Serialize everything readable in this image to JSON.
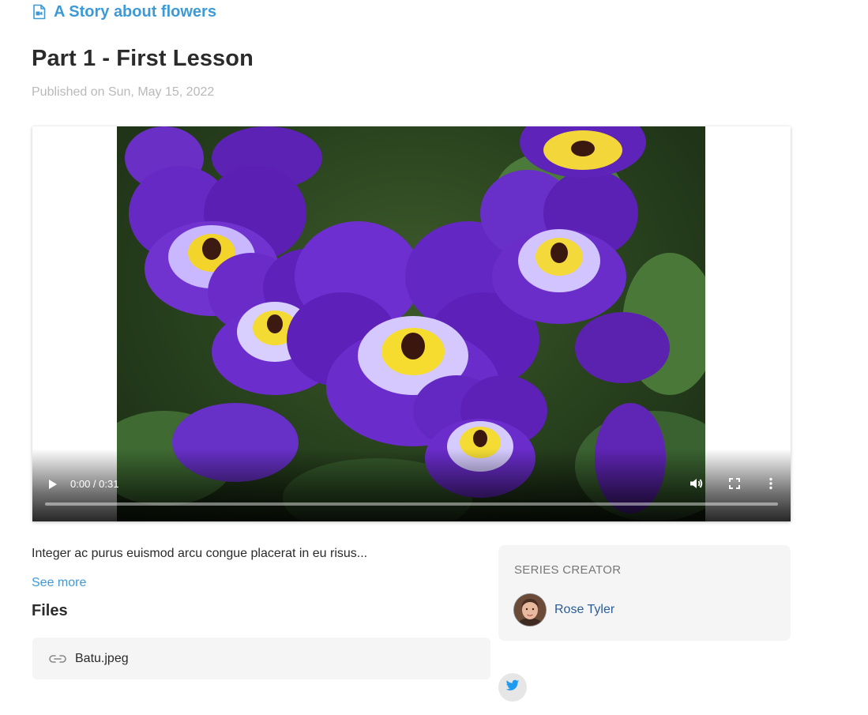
{
  "series": {
    "title": "A Story about flowers",
    "icon": "video-file-icon"
  },
  "episode": {
    "title": "Part 1 - First Lesson",
    "published": "Published on Sun, May 15, 2022"
  },
  "video_player": {
    "time_display": "0:00 / 0:31",
    "progress": 0,
    "icons": [
      "play-icon",
      "volume-icon",
      "fullscreen-icon",
      "more-options-icon"
    ]
  },
  "description": {
    "text": "Integer ac purus euismod arcu congue placerat in eu risus...",
    "see_more_label": "See more"
  },
  "files": {
    "heading": "Files",
    "items": [
      {
        "name": "Batu.jpeg",
        "icon": "link-icon"
      }
    ]
  },
  "creator": {
    "label": "SERIES CREATOR",
    "name": "Rose Tyler"
  },
  "social": {
    "icon": "twitter-icon"
  },
  "colors": {
    "accent": "#3d9ad6",
    "creator_link": "#2c5c97",
    "muted": "#b9b9b9",
    "card_bg": "#f5f5f5"
  }
}
